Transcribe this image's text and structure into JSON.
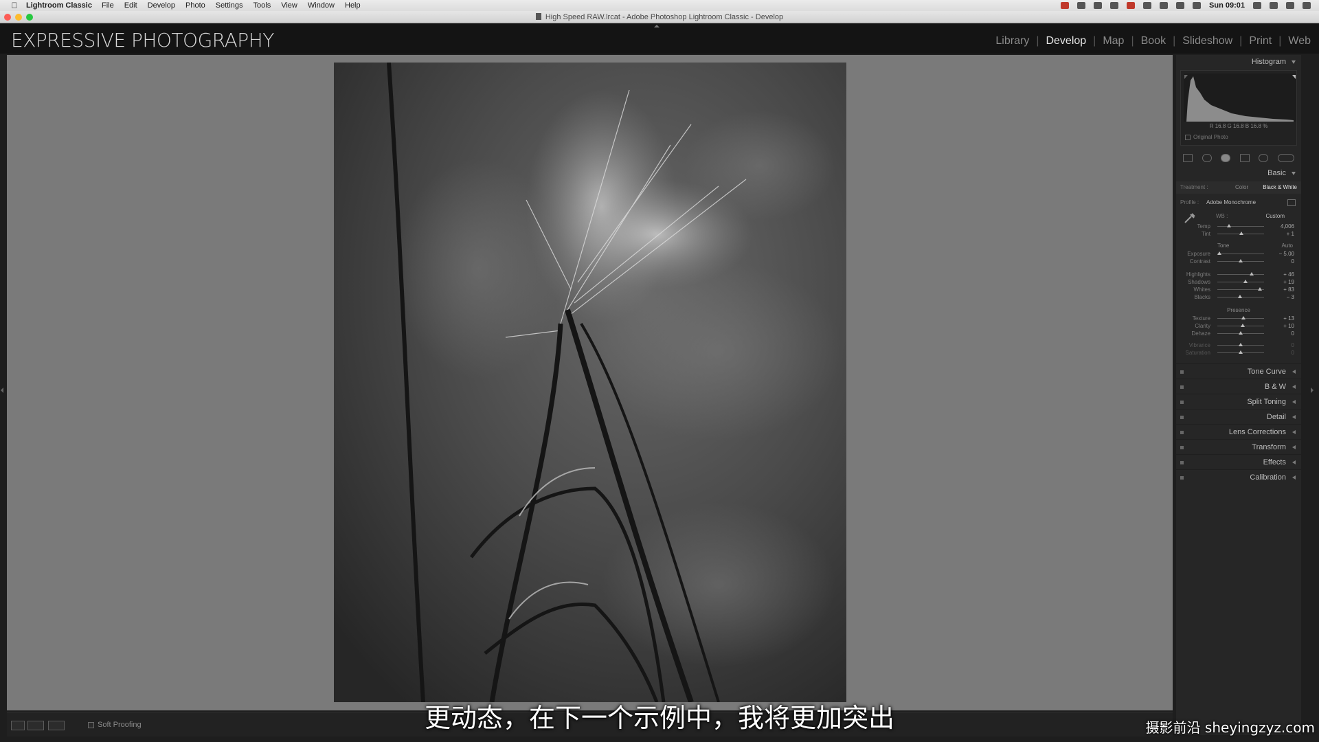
{
  "menubar": {
    "app_name": "Lightroom Classic",
    "items": [
      "File",
      "Edit",
      "Develop",
      "Photo",
      "Settings",
      "Tools",
      "View",
      "Window",
      "Help"
    ],
    "clock": "Sun 09:01"
  },
  "window": {
    "title": "High Speed RAW.lrcat - Adobe Photoshop Lightroom Classic - Develop"
  },
  "identity": {
    "logo": "EXPRESSIVE PHOTOGRAPHY",
    "modules": [
      "Library",
      "Develop",
      "Map",
      "Book",
      "Slideshow",
      "Print",
      "Web"
    ],
    "active_module": "Develop"
  },
  "toolbar": {
    "soft_proofing_label": "Soft Proofing"
  },
  "histogram": {
    "title": "Histogram",
    "r_label": "R",
    "r_value": "16.8",
    "g_label": "G",
    "g_value": "16.8",
    "b_label": "B",
    "b_value": "16.8",
    "percent": "%",
    "original_photo_label": "Original Photo"
  },
  "basic": {
    "title": "Basic",
    "treatment_label": "Treatment :",
    "treatment_color": "Color",
    "treatment_bw": "Black & White",
    "profile_label": "Profile :",
    "profile_value": "Adobe Monochrome",
    "wb_label": "WB :",
    "wb_value": "Custom",
    "tone_label": "Tone",
    "auto_label": "Auto",
    "presence_label": "Presence",
    "wb_sliders": [
      {
        "label": "Temp",
        "value": "4,006",
        "pos": 0.25
      },
      {
        "label": "Tint",
        "value": "+ 1",
        "pos": 0.51
      }
    ],
    "tone_sliders": [
      {
        "label": "Exposure",
        "value": "− 5.00",
        "pos": 0.05
      },
      {
        "label": "Contrast",
        "value": "0",
        "pos": 0.5
      }
    ],
    "tone_sliders_2": [
      {
        "label": "Highlights",
        "value": "+ 46",
        "pos": 0.73
      },
      {
        "label": "Shadows",
        "value": "+ 19",
        "pos": 0.6
      },
      {
        "label": "Whites",
        "value": "+ 83",
        "pos": 0.91
      },
      {
        "label": "Blacks",
        "value": "− 3",
        "pos": 0.48
      }
    ],
    "presence_sliders": [
      {
        "label": "Texture",
        "value": "+ 13",
        "pos": 0.56
      },
      {
        "label": "Clarity",
        "value": "+ 10",
        "pos": 0.55
      },
      {
        "label": "Dehaze",
        "value": "0",
        "pos": 0.5
      }
    ],
    "presence_sliders_dim": [
      {
        "label": "Vibrance",
        "value": "0",
        "pos": 0.5
      },
      {
        "label": "Saturation",
        "value": "0",
        "pos": 0.5
      }
    ]
  },
  "sections": [
    "Tone Curve",
    "B & W",
    "Split Toning",
    "Detail",
    "Lens Corrections",
    "Transform",
    "Effects",
    "Calibration"
  ],
  "subtitle": "更动态，在下一个示例中，我将更加突出",
  "watermark": "摄影前沿 sheyingzyz.com"
}
